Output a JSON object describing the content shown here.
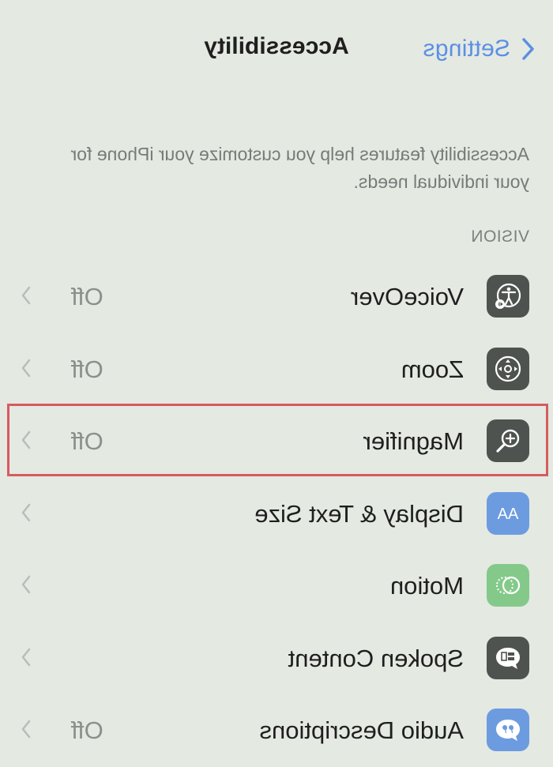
{
  "nav": {
    "back_label": "Settings",
    "title": "Accessibility"
  },
  "description": "Accessibility features help you customize your iPhone for your individual needs.",
  "section_header": "VISION",
  "rows": [
    {
      "title": "VoiceOver",
      "value": "Off",
      "icon": "voiceover-icon",
      "icon_color": "#4f534f"
    },
    {
      "title": "Zoom",
      "value": "Off",
      "icon": "zoom-icon",
      "icon_color": "#4f534f"
    },
    {
      "title": "Magnifier",
      "value": "Off",
      "icon": "magnifier-icon",
      "icon_color": "#4f534f"
    },
    {
      "title": "Display & Text Size",
      "value": "",
      "icon": "text-size-icon",
      "icon_color": "#6d9be0"
    },
    {
      "title": "Motion",
      "value": "",
      "icon": "motion-icon",
      "icon_color": "#84c98a"
    },
    {
      "title": "Spoken Content",
      "value": "",
      "icon": "spoken-content-icon",
      "icon_color": "#4f534f"
    },
    {
      "title": "Audio Descriptions",
      "value": "Off",
      "icon": "audio-descriptions-icon",
      "icon_color": "#6d9be0"
    }
  ],
  "colors": {
    "background": "#e4e9e2",
    "accent": "#5b8fe3",
    "highlight": "#d65b5e"
  }
}
